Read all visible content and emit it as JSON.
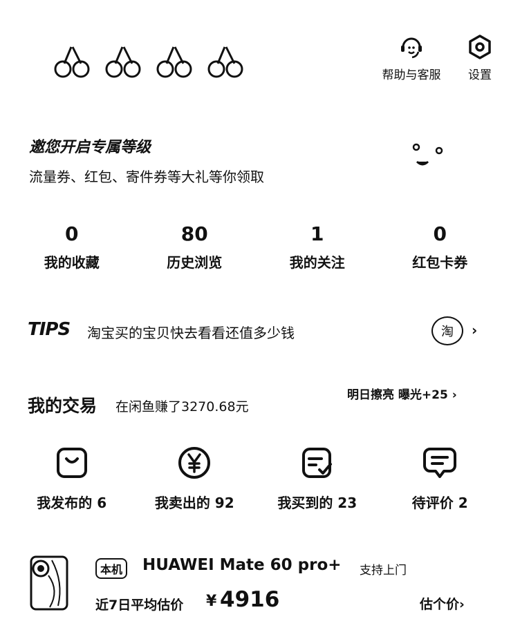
{
  "header": {
    "avatar_decorations": [
      "cherry-icon",
      "cherry-icon",
      "cherry-icon",
      "cherry-icon"
    ],
    "help_label": "帮助与客服",
    "settings_label": "设置"
  },
  "banner": {
    "title": "邀您开启专属等级",
    "subtitle": "流量券、红包、寄件券等大礼等你领取"
  },
  "stats": [
    {
      "value": "0",
      "label": "我的收藏"
    },
    {
      "value": "80",
      "label": "历史浏览"
    },
    {
      "value": "1",
      "label": "我的关注"
    },
    {
      "value": "0",
      "label": "红包卡券"
    }
  ],
  "tips": {
    "logo": "TIPS",
    "text": "淘宝买的宝贝快去看看还值多少钱",
    "badge": "淘",
    "arrow": "›"
  },
  "trades": {
    "title": "我的交易",
    "subtitle": "在闲鱼赚了3270.68元",
    "promote_label": "明日擦亮 曝光+25 ›",
    "items": [
      {
        "label": "我发布的 6",
        "icon": "bag-icon"
      },
      {
        "label": "我卖出的 92",
        "icon": "yen-icon"
      },
      {
        "label": "我买到的 23",
        "icon": "receipt-check-icon"
      },
      {
        "label": "待评价 2",
        "icon": "comment-icon"
      }
    ]
  },
  "device": {
    "tag": "本机",
    "name": "HUAWEI Mate 60 pro+",
    "service": "支持上门",
    "price_label": "近7日平均估价",
    "currency": "¥",
    "price": "4916",
    "estimate_label": "估个价›"
  }
}
